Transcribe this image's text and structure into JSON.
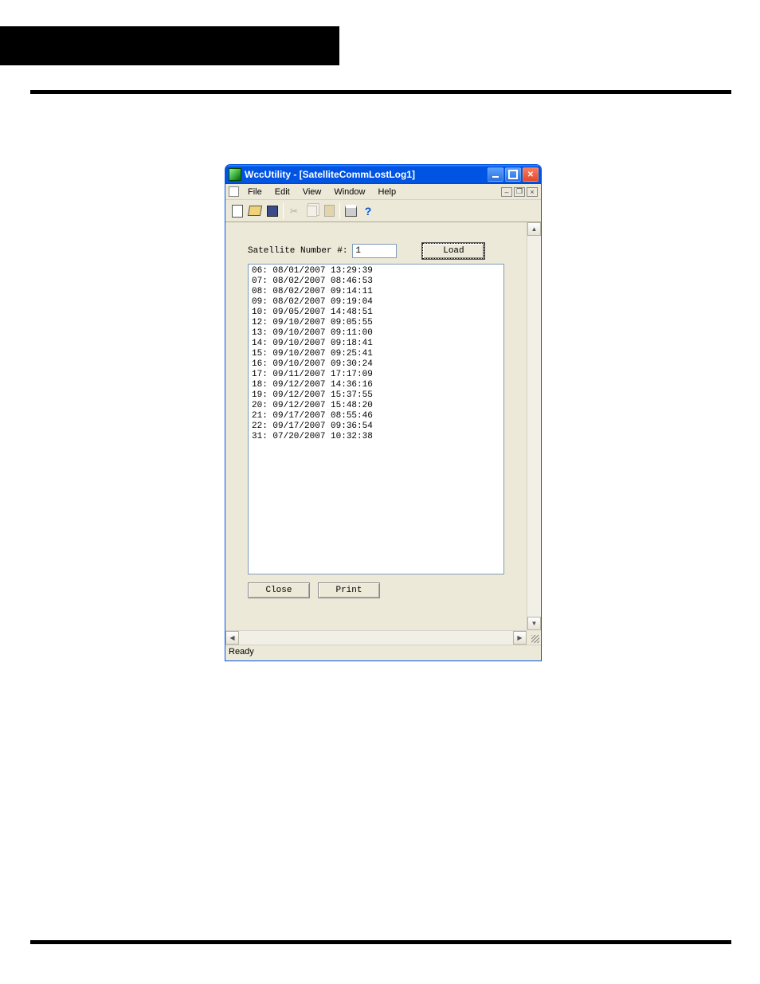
{
  "window": {
    "title": "WccUtility - [SatelliteCommLostLog1]"
  },
  "menus": {
    "file": "File",
    "edit": "Edit",
    "view": "View",
    "window": "Window",
    "help": "Help"
  },
  "toolbar": {
    "new": "new-icon",
    "open": "open-icon",
    "save": "save-icon",
    "cut": "cut-icon",
    "copy": "copy-icon",
    "paste": "paste-icon",
    "print": "print-icon",
    "help": "help-icon"
  },
  "form": {
    "sat_label": "Satellite Number #:",
    "sat_value": "1",
    "load_label": "Load",
    "close_label": "Close",
    "print_label": "Print"
  },
  "log_entries": [
    "06: 08/01/2007 13:29:39",
    "07: 08/02/2007 08:46:53",
    "08: 08/02/2007 09:14:11",
    "09: 08/02/2007 09:19:04",
    "10: 09/05/2007 14:48:51",
    "12: 09/10/2007 09:05:55",
    "13: 09/10/2007 09:11:00",
    "14: 09/10/2007 09:18:41",
    "15: 09/10/2007 09:25:41",
    "16: 09/10/2007 09:30:24",
    "17: 09/11/2007 17:17:09",
    "18: 09/12/2007 14:36:16",
    "19: 09/12/2007 15:37:55",
    "20: 09/12/2007 15:48:20",
    "21: 09/17/2007 08:55:46",
    "22: 09/17/2007 09:36:54",
    "31: 07/20/2007 10:32:38"
  ],
  "status": {
    "text": "Ready"
  }
}
